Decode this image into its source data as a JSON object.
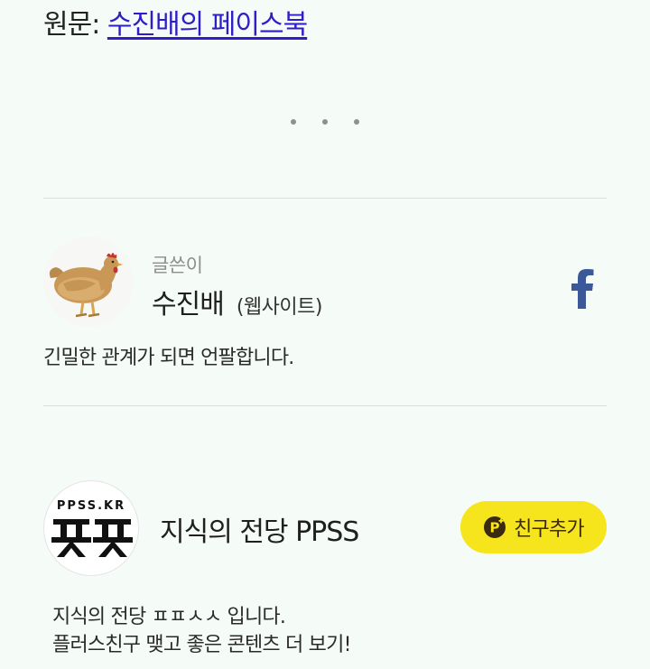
{
  "source": {
    "prefix": "원문: ",
    "link_text": "수진배의 페이스북"
  },
  "author": {
    "caption": "글쓴이",
    "name": "수진배",
    "website_label": "(웹사이트)",
    "bio": "긴밀한 관계가 되면 언팔합니다.",
    "avatar_icon": "chicken-image",
    "social_icon": "facebook-icon"
  },
  "ppss": {
    "logo_text": "PPSS.KR",
    "logo_glyph": "ㅍㅍ",
    "name": "지식의 전당 PPSS",
    "add_friend_label": "친구추가",
    "description": [
      "지식의 전당 ㅍㅍㅅㅅ 입니다.",
      "플러스친구 맺고 좋은 콘텐츠 더 보기!"
    ]
  },
  "colors": {
    "background": "#f5fbf6",
    "link": "#2d1ec9",
    "facebook": "#3b5998",
    "kakao_yellow": "#f6e41c",
    "divider": "#dcdcdc"
  }
}
